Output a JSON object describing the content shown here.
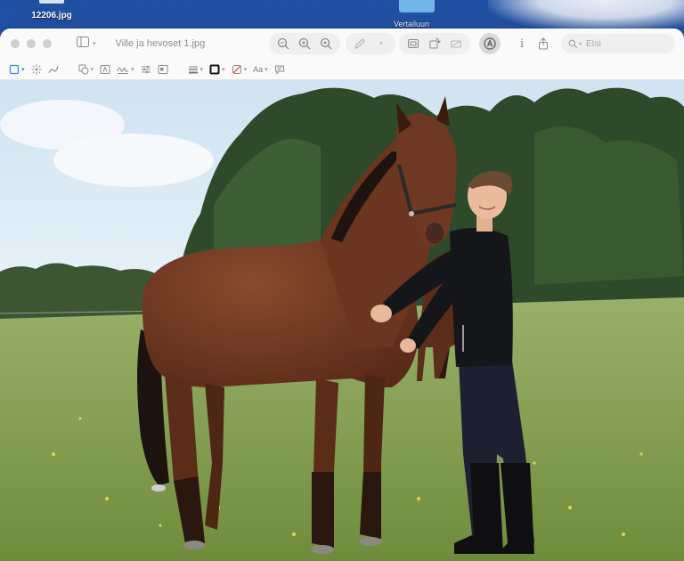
{
  "desktop": {
    "file_label": "12206.jpg",
    "folder_label": "Vertailuun"
  },
  "window": {
    "title": "Ville ja hevoset 1.jpg",
    "search": {
      "placeholder": "Etsi",
      "value": ""
    },
    "toolbar": {
      "icons": [
        "sidebar-icon",
        "zoom-out-icon",
        "zoom-in-icon",
        "zoom-fit-icon",
        "pen-icon",
        "crop-icon",
        "rotate-icon",
        "adjust-icon",
        "markup-icon",
        "info-icon",
        "share-icon",
        "search-icon"
      ]
    },
    "markup_tools": {
      "font_label": "Aa"
    }
  },
  "photo": {
    "subject": "man in black standing beside a bay horse in a grass field",
    "colors": {
      "sky": "#cfe3f2",
      "trees": "#2f4a2a",
      "grass": "#7f9b4a",
      "horse": "#6b3520",
      "jacket": "#15161a"
    }
  }
}
